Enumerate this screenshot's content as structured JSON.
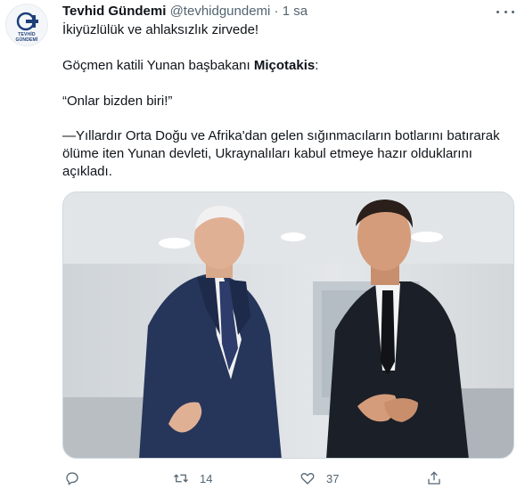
{
  "tweet": {
    "author_name": "Tevhid Gündemi",
    "handle": "@tevhidgundemi",
    "separator": "·",
    "time": "1 sa",
    "avatar_text": "TEVHİD GÜNDEMİ",
    "line1": "İkiyüzlülük ve ahlaksızlık zirvede!",
    "line2_prefix": "Göçmen katili Yunan başbakanı ",
    "line2_bold": "Miçotakis",
    "line2_suffix": ":",
    "line3": "“Onlar bizden biri!”",
    "line4": "—Yıllardır Orta Doğu ve Afrika'dan gelen sığınmacıların botlarını batırarak ölüme iten Yunan devleti, Ukraynalıları kabul etmeye hazır olduklarını açıkladı."
  },
  "actions": {
    "reply_icon": "reply-icon",
    "retweet_icon": "retweet-icon",
    "retweet_count": "14",
    "like_icon": "heart-icon",
    "like_count": "37",
    "share_icon": "share-icon"
  },
  "colors": {
    "text": "#0f1419",
    "muted": "#536471",
    "border": "#cfd9de"
  }
}
